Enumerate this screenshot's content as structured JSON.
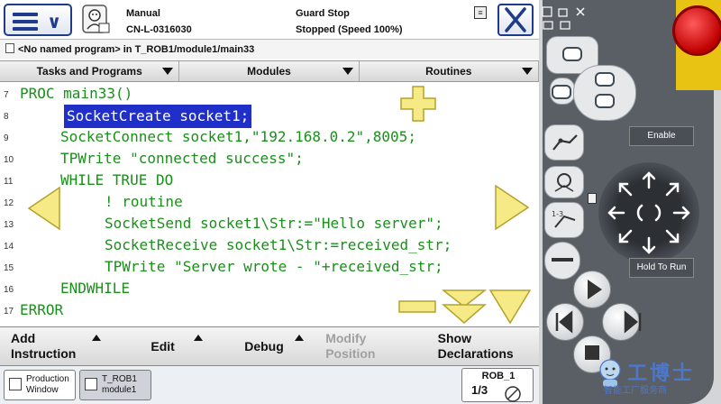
{
  "status": {
    "mode": "Manual",
    "controller": "CN-L-0316030",
    "guard": "Guard Stop",
    "state": "Stopped (Speed 100%)"
  },
  "program_bar": {
    "text": "<No named program> in T_ROB1/module1/main33"
  },
  "tabs": [
    {
      "label": "Tasks and Programs"
    },
    {
      "label": "Modules"
    },
    {
      "label": "Routines"
    }
  ],
  "code": {
    "lines": [
      {
        "num": "7",
        "text": "PROC main33()"
      },
      {
        "num": "8",
        "text": "SocketCreate socket1;"
      },
      {
        "num": "9",
        "text": "SocketConnect socket1,\"192.168.0.2\",8005;"
      },
      {
        "num": "10",
        "text": "TPWrite \"connected success\";"
      },
      {
        "num": "11",
        "text": "WHILE TRUE DO"
      },
      {
        "num": "12",
        "text": "! routine"
      },
      {
        "num": "13",
        "text": "SocketSend socket1\\Str:=\"Hello server\";"
      },
      {
        "num": "14",
        "text": "SocketReceive socket1\\Str:=received_str;"
      },
      {
        "num": "15",
        "text": "TPWrite \"Server wrote - \"+received_str;"
      },
      {
        "num": "16",
        "text": "ENDWHILE"
      },
      {
        "num": "17",
        "text": "ERROR"
      }
    ]
  },
  "bottom_menu": {
    "add_instruction_1": "Add",
    "add_instruction_2": "Instruction",
    "edit": "Edit",
    "debug": "Debug",
    "modify_1": "Modify",
    "modify_2": "Position",
    "show_1": "Show",
    "show_2": "Declarations"
  },
  "taskbar": {
    "production_1": "Production",
    "production_2": "Window",
    "rob_1": "T_ROB1",
    "rob_2": "module1",
    "rob_label": "ROB_1",
    "rob_fraction": "1/3"
  },
  "device": {
    "enable_label": "Enable",
    "hold_label": "Hold To Run"
  },
  "watermark": {
    "brand": "工博士",
    "tagline": "智能工厂服务商"
  }
}
